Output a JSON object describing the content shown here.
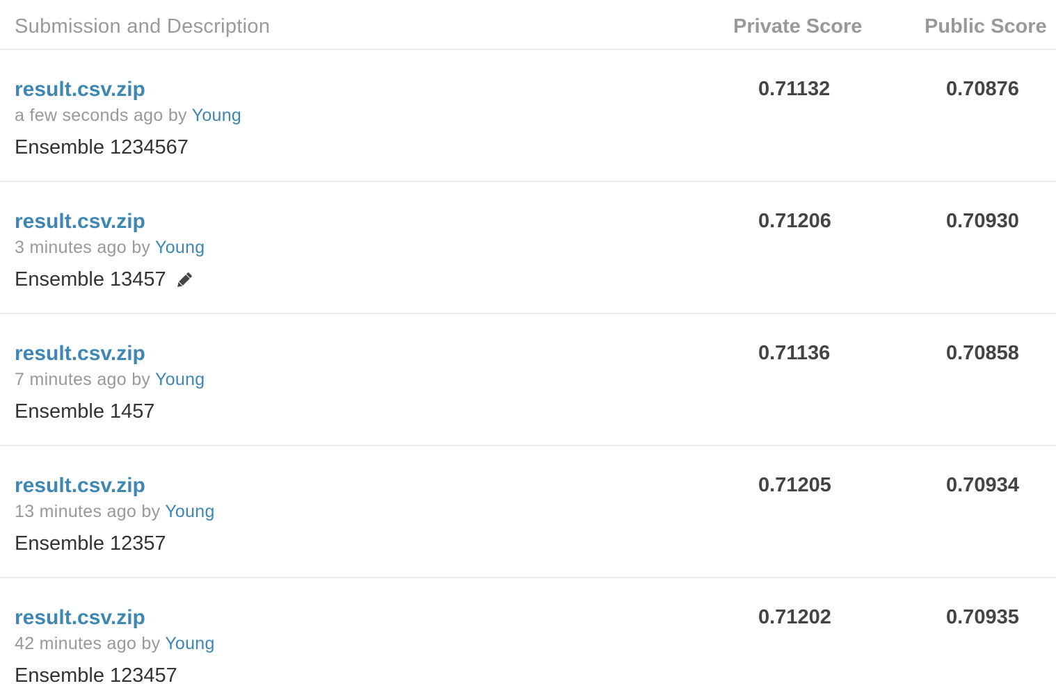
{
  "header": {
    "description": "Submission and Description",
    "private_score": "Private Score",
    "public_score": "Public Score"
  },
  "submissions": [
    {
      "file": "result.csv.zip",
      "time": "a few seconds ago",
      "by": "by",
      "user": "Young",
      "description": "Ensemble 1234567",
      "private_score": "0.71132",
      "public_score": "0.70876",
      "edit_icon": false
    },
    {
      "file": "result.csv.zip",
      "time": "3 minutes ago",
      "by": "by",
      "user": "Young",
      "description": "Ensemble 13457",
      "private_score": "0.71206",
      "public_score": "0.70930",
      "edit_icon": true
    },
    {
      "file": "result.csv.zip",
      "time": "7 minutes ago",
      "by": "by",
      "user": "Young",
      "description": "Ensemble 1457",
      "private_score": "0.71136",
      "public_score": "0.70858",
      "edit_icon": false
    },
    {
      "file": "result.csv.zip",
      "time": "13 minutes ago",
      "by": "by",
      "user": "Young",
      "description": "Ensemble 12357",
      "private_score": "0.71205",
      "public_score": "0.70934",
      "edit_icon": false
    },
    {
      "file": "result.csv.zip",
      "time": "42 minutes ago",
      "by": "by",
      "user": "Young",
      "description": "Ensemble 123457",
      "private_score": "0.71202",
      "public_score": "0.70935",
      "edit_icon": false
    }
  ],
  "colors": {
    "link": "#3e86b3",
    "header_text": "#999999",
    "body_text": "#333333",
    "score_text": "#444444"
  },
  "icons": {
    "edit": "pencil-icon"
  }
}
